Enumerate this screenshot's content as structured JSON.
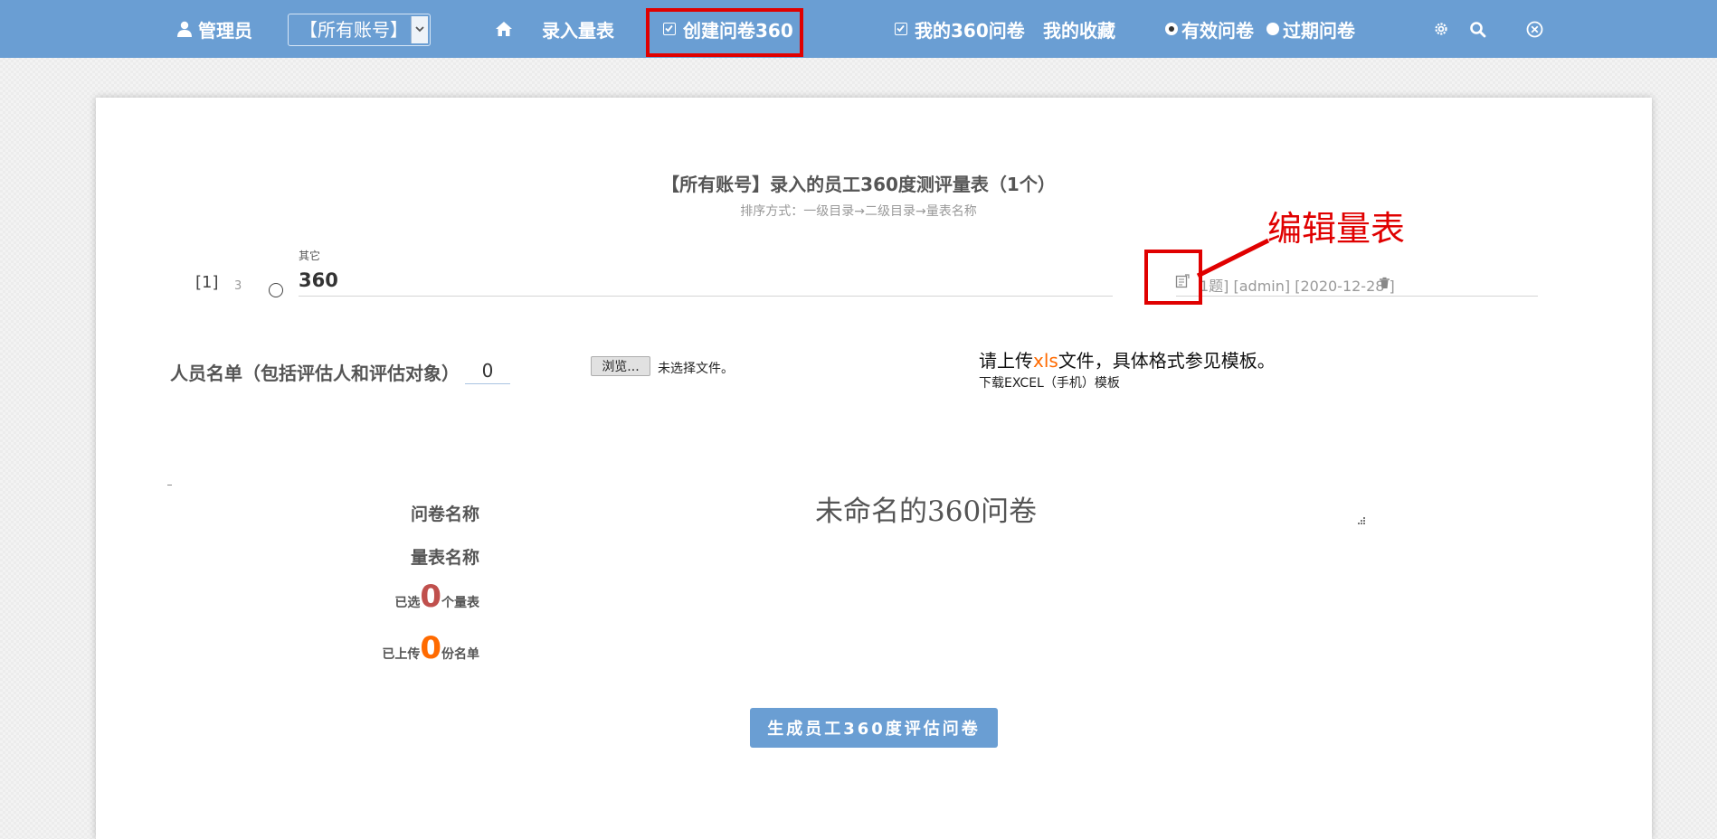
{
  "topbar": {
    "user_label": "管理员",
    "account_select_value": "【所有账号】",
    "nav_enter_scale": "录入量表",
    "nav_create_360": "创建问卷360",
    "nav_my_360": "我的360问卷",
    "nav_favorites": "我的收藏",
    "filter_valid": "有效问卷",
    "filter_expired": "过期问卷"
  },
  "list": {
    "title": "【所有账号】录入的员工360度测评量表（1个）",
    "sort_note": "排序方式：一级目录→二级目录→量表名称",
    "items": [
      {
        "index": "[1]",
        "count": "3",
        "category": "其它",
        "name": "360",
        "meta": "1题] [admin] [2020-12-28 ]"
      }
    ]
  },
  "annotation": {
    "text": "编辑量表"
  },
  "people": {
    "label": "人员名单（包括评估人和评估对象）",
    "count": "0",
    "browse_label": "浏览...",
    "file_status": "未选择文件。",
    "upload_prefix": "请上传",
    "upload_ext": "xls",
    "upload_suffix": "文件，具体格式参见模板。",
    "template_link": "下载EXCEL（手机）模板"
  },
  "form": {
    "survey_name_label": "问卷名称",
    "survey_name_value": "未命名的360问卷",
    "scale_name_label": "量表名称",
    "selected_prefix": "已选",
    "selected_count": "0",
    "selected_suffix": "个量表",
    "uploaded_prefix": "已上传",
    "uploaded_count": "0",
    "uploaded_suffix": "份名单",
    "generate_button": "生成员工360度评估问卷"
  },
  "icons": {
    "user": "user-icon",
    "home": "home-icon",
    "settings": "gear-icon",
    "search": "search-icon",
    "close": "close-circle-icon",
    "edit": "edit-icon",
    "delete": "trash-icon"
  },
  "colors": {
    "topbar_bg": "#6a9ed3",
    "highlight_red": "#e00000",
    "count_red": "#c0504d",
    "count_orange": "#ff6a00"
  }
}
